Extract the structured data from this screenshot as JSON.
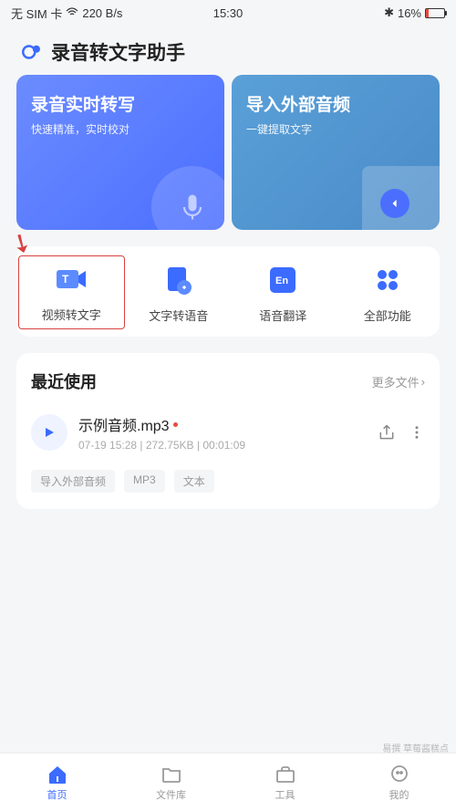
{
  "status": {
    "sim": "无 SIM 卡",
    "speed": "220 B/s",
    "time": "15:30",
    "battery_pct": "16%"
  },
  "app": {
    "title": "录音转文字助手"
  },
  "hero": [
    {
      "title": "录音实时转写",
      "subtitle": "快速精准，实时校对"
    },
    {
      "title": "导入外部音频",
      "subtitle": "一键提取文字"
    }
  ],
  "features": [
    {
      "label": "视频转文字",
      "icon": "video-text"
    },
    {
      "label": "文字转语音",
      "icon": "text-speech"
    },
    {
      "label": "语音翻译",
      "icon": "translate"
    },
    {
      "label": "全部功能",
      "icon": "all"
    }
  ],
  "recent": {
    "title": "最近使用",
    "more": "更多文件",
    "file": {
      "name": "示例音频.mp3",
      "meta": "07-19 15:28 | 272.75KB | 00:01:09"
    },
    "tags": [
      "导入外部音频",
      "MP3",
      "文本"
    ]
  },
  "nav": [
    {
      "label": "首页",
      "active": true
    },
    {
      "label": "文件库",
      "active": false
    },
    {
      "label": "工具",
      "active": false
    },
    {
      "label": "我的",
      "active": false
    }
  ],
  "watermark": "易撰 草莓酱糕点"
}
